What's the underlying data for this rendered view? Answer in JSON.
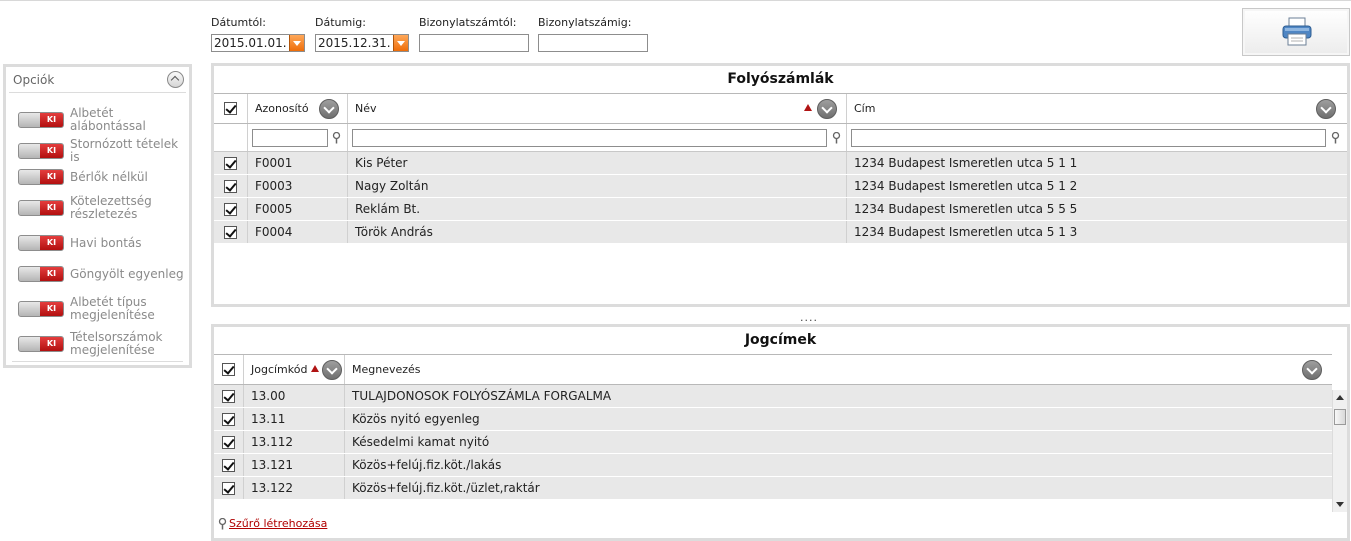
{
  "filters": {
    "date_from": {
      "label": "Dátumtól:",
      "value": "2015.01.01."
    },
    "date_to": {
      "label": "Dátumig:",
      "value": "2015.12.31."
    },
    "doc_from": {
      "label": "Bizonylatszámtól:",
      "value": ""
    },
    "doc_to": {
      "label": "Bizonylatszámig:",
      "value": ""
    }
  },
  "options": {
    "title": "Opciók",
    "toggle_state": "KI",
    "items": [
      {
        "label": "Albetét alábontással"
      },
      {
        "label": "Stornózott tételek is"
      },
      {
        "label": "Bérlők nélkül"
      },
      {
        "label": "Kötelezettség részletezés"
      },
      {
        "label": "Havi bontás"
      },
      {
        "label": "Göngyölt egyenleg"
      },
      {
        "label": "Albetét típus megjelenítése"
      },
      {
        "label": "Tételsorszámok megjelenítése"
      }
    ]
  },
  "accounts": {
    "title": "Folyószámlák",
    "columns": {
      "id": "Azonosító",
      "name": "Név",
      "address": "Cím"
    },
    "rows": [
      {
        "id": "F0001",
        "name": "Kis Péter",
        "address": "1234 Budapest Ismeretlen utca 5 1 1"
      },
      {
        "id": "F0003",
        "name": "Nagy Zoltán",
        "address": "1234 Budapest Ismeretlen utca 5 1 2"
      },
      {
        "id": "F0005",
        "name": "Reklám Bt.",
        "address": "1234 Budapest Ismeretlen utca 5 5 5"
      },
      {
        "id": "F0004",
        "name": "Török András",
        "address": "1234 Budapest Ismeretlen utca 5 1 3"
      }
    ]
  },
  "splitter": "....",
  "titles": {
    "title": "Jogcímek",
    "columns": {
      "code": "Jogcímkód",
      "name": "Megnevezés"
    },
    "rows": [
      {
        "code": "13.00",
        "name": "TULAJDONOSOK FOLYÓSZÁMLA FORGALMA"
      },
      {
        "code": "13.11",
        "name": "Közös nyitó egyenleg"
      },
      {
        "code": "13.112",
        "name": "Késedelmi kamat nyitó"
      },
      {
        "code": "13.121",
        "name": "Közös+felúj.fiz.köt./lakás"
      },
      {
        "code": "13.122",
        "name": "Közös+felúj.fiz.köt./üzlet,raktár"
      }
    ]
  },
  "filter_link": "Szűrő létrehozása",
  "colors": {
    "accent_orange": "#ee6d0a",
    "toggle_red": "#c41d1d",
    "link_red": "#b00000",
    "row_gray": "#e8e8e8"
  },
  "icons": [
    "printer-icon",
    "collapse-up-icon",
    "sort-dropdown-icon",
    "sort-ascending-icon",
    "filter-icon"
  ]
}
